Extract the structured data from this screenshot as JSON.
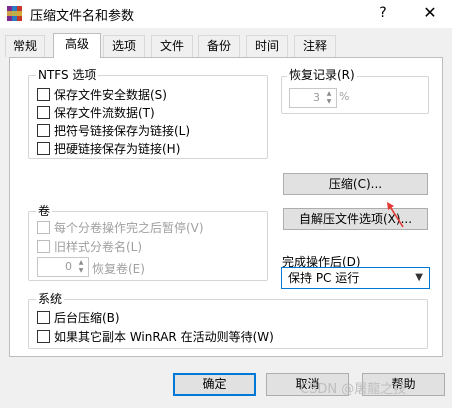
{
  "window": {
    "title": "压缩文件名和参数",
    "help_glyph": "?",
    "close_glyph": "✕"
  },
  "tabs": [
    "常规",
    "高级",
    "选项",
    "文件",
    "备份",
    "时间",
    "注释"
  ],
  "active_tab": "高级",
  "ntfs": {
    "title": "NTFS 选项",
    "options": [
      {
        "label": "保存文件安全数据(S)",
        "checked": false
      },
      {
        "label": "保存文件流数据(T)",
        "checked": false
      },
      {
        "label": "把符号链接保存为链接(L)",
        "checked": false
      },
      {
        "label": "把硬链接保存为链接(H)",
        "checked": false
      }
    ]
  },
  "recovery": {
    "title": "恢复记录(R)",
    "value": "3",
    "unit": "%"
  },
  "compress_button": "压缩(C)...",
  "sfx_button": "自解压文件选项(X)...",
  "volume": {
    "title": "卷",
    "options": [
      {
        "label": "每个分卷操作完之后暂停(V)",
        "checked": false
      },
      {
        "label": "旧样式分卷名(L)",
        "checked": false
      }
    ],
    "recovery_value": "0",
    "recovery_label": "恢复卷(E)"
  },
  "after_done": {
    "label": "完成操作后(D)",
    "selected": "保持 PC 运行"
  },
  "system": {
    "title": "系统",
    "options": [
      {
        "label": "后台压缩(B)",
        "checked": false
      },
      {
        "label": "如果其它副本 WinRAR 在活动则等待(W)",
        "checked": false
      }
    ]
  },
  "buttons": {
    "ok": "确定",
    "cancel": "取消",
    "help": "帮助"
  },
  "watermark": "CSDN @屠龍之技",
  "colors": {
    "accent": "#0078d7",
    "annotation_arrow": "#e53935"
  }
}
